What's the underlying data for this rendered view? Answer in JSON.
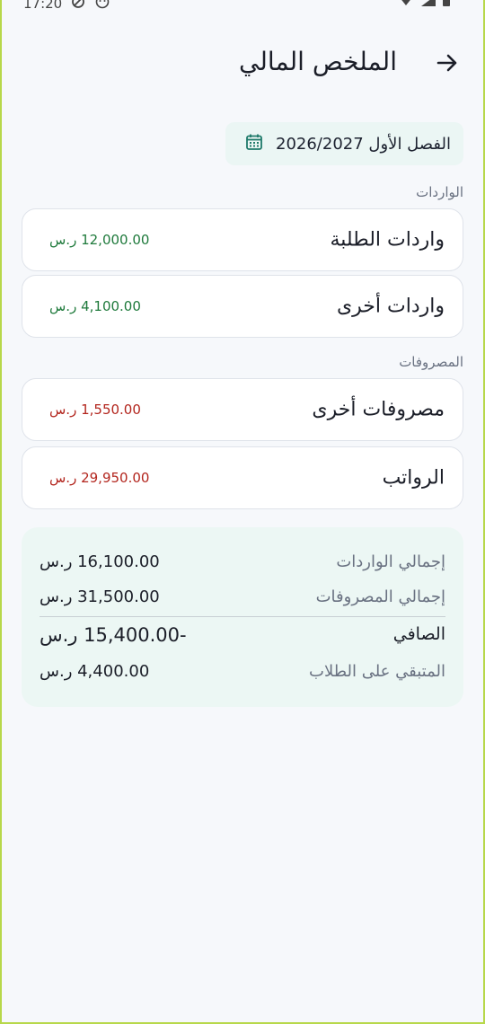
{
  "status": {
    "time": "17:20"
  },
  "header": {
    "title": "الملخص المالي"
  },
  "term": {
    "label": "الفصل الأول 2026/2027"
  },
  "income": {
    "section_label": "الواردات",
    "items": [
      {
        "label": "واردات الطلبة",
        "amount": "12,000.00 ر.س"
      },
      {
        "label": "واردات أخرى",
        "amount": "4,100.00 ر.س"
      }
    ]
  },
  "expenses": {
    "section_label": "المصروفات",
    "items": [
      {
        "label": "مصروفات أخرى",
        "amount": "1,550.00 ر.س"
      },
      {
        "label": "الرواتب",
        "amount": "29,950.00 ر.س"
      }
    ]
  },
  "summary": {
    "total_income_label": "إجمالي الواردات",
    "total_income_value": "16,100.00 ر.س",
    "total_expenses_label": "إجمالي المصروفات",
    "total_expenses_value": "31,500.00 ر.س",
    "net_label": "الصافي",
    "net_value": "-15,400.00 ر.س",
    "remaining_label": "المتبقي على الطلاب",
    "remaining_value": "4,400.00 ر.س"
  },
  "colors": {
    "income": "#1f7a3c",
    "expense": "#b3261e",
    "accent": "#1f7a6a"
  }
}
